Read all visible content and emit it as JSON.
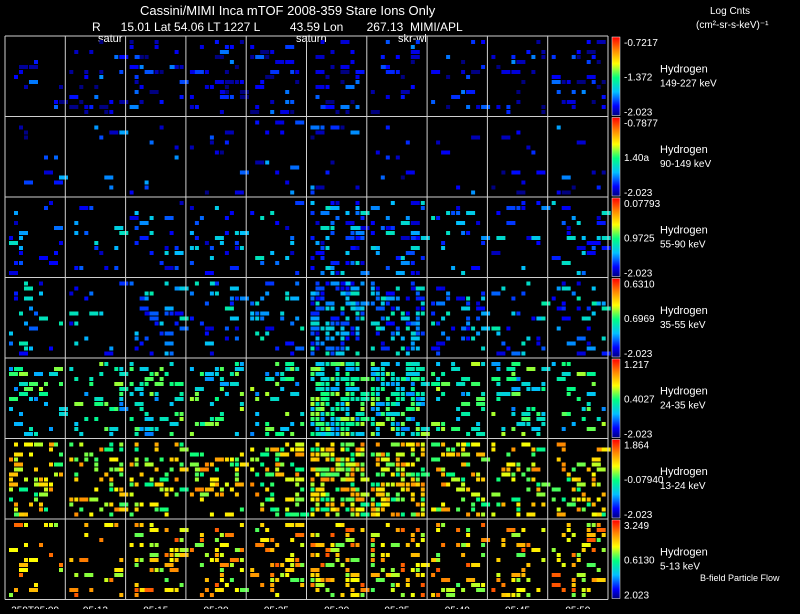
{
  "header": {
    "title": "Cassini/MIMI Inca mTOF  2008-359   Stare    Ions Only",
    "info_line": "R      15.01 Lat 54.06 LT 1227 L         43.59 Lon       267.13  MIMI/APL",
    "labels": [
      "satur",
      "saturn",
      "skr-wl"
    ],
    "units_line1": "Log Cnts",
    "units_line2": "(cm²-sr-s-keV)⁻¹"
  },
  "footer": {
    "time_labels": [
      "359T05:09",
      "05:12",
      "05:15",
      "05:20",
      "05:25",
      "05:30",
      "05:35",
      "05:40",
      "05:45",
      "05:50"
    ],
    "flow_label": "B-field Particle Flow"
  },
  "chart_data": {
    "type": "heatmap",
    "title": "Cassini/MIMI Inca mTOF  2008-359   Stare    Ions Only",
    "columns": [
      "359T05:09",
      "05:12",
      "05:15",
      "05:20",
      "05:25",
      "05:30",
      "05:35",
      "05:40",
      "05:45",
      "05:50"
    ],
    "rows": [
      {
        "species": "Hydrogen",
        "range": "149-227 keV",
        "max_label": "-0.7217",
        "mid_label": "-1.372",
        "min_label": "-2.023",
        "mean": 0.12,
        "density": [
          0.1,
          0.12,
          0.18,
          0.15,
          0.12,
          0.14,
          0.12,
          0.1,
          0.12,
          0.14
        ]
      },
      {
        "species": "Hydrogen",
        "range": "90-149 keV",
        "max_label": "-0.7877",
        "mid_label": "1.40a",
        "min_label": "-2.023",
        "mean": 0.15,
        "density": [
          0.05,
          0.06,
          0.07,
          0.05,
          0.06,
          0.08,
          0.06,
          0.05,
          0.06,
          0.05
        ]
      },
      {
        "species": "Hydrogen",
        "range": "55-90 keV",
        "max_label": "0.07793",
        "mid_label": "0.9725",
        "min_label": "-2.023",
        "mean": 0.25,
        "density": [
          0.08,
          0.07,
          0.1,
          0.1,
          0.08,
          0.3,
          0.2,
          0.08,
          0.12,
          0.1
        ]
      },
      {
        "species": "Hydrogen",
        "range": "35-55 keV",
        "max_label": "0.6310",
        "mid_label": "0.6969",
        "min_label": "-2.023",
        "mean": 0.28,
        "density": [
          0.12,
          0.1,
          0.16,
          0.14,
          0.14,
          0.55,
          0.45,
          0.2,
          0.18,
          0.16
        ]
      },
      {
        "species": "Hydrogen",
        "range": "24-35 keV",
        "max_label": "1.217",
        "mid_label": "0.4027",
        "min_label": "-2.023",
        "mean": 0.45,
        "density": [
          0.2,
          0.18,
          0.22,
          0.2,
          0.22,
          0.6,
          0.55,
          0.25,
          0.22,
          0.16
        ]
      },
      {
        "species": "Hydrogen",
        "range": "13-24 keV",
        "max_label": "1.864",
        "mid_label": "-0.07940",
        "min_label": "-2.023",
        "mean": 0.65,
        "density": [
          0.22,
          0.25,
          0.3,
          0.28,
          0.3,
          0.65,
          0.55,
          0.3,
          0.25,
          0.2
        ]
      },
      {
        "species": "Hydrogen",
        "range": "5-13 keV",
        "max_label": "3.249",
        "mid_label": "0.6130",
        "min_label": "2.023",
        "mean": 0.72,
        "density": [
          0.12,
          0.1,
          0.22,
          0.25,
          0.22,
          0.32,
          0.3,
          0.22,
          0.16,
          0.18
        ]
      }
    ],
    "colorscale": [
      "#000080",
      "#0000ff",
      "#00bfff",
      "#00ff80",
      "#ffff00",
      "#ff8000",
      "#ff0000"
    ],
    "grid": true,
    "legend_placement": "right"
  }
}
